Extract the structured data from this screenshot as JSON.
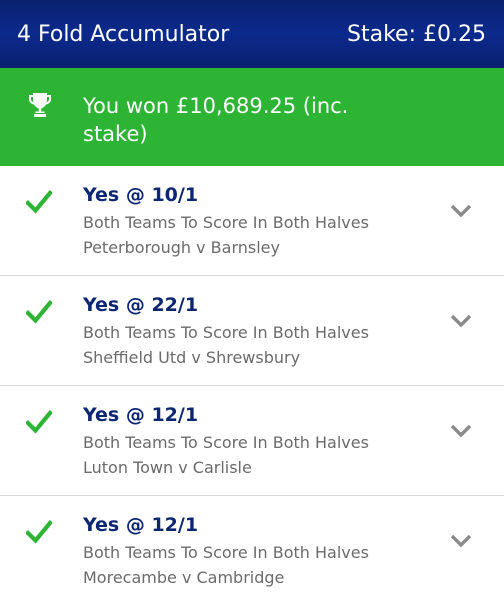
{
  "header": {
    "title": "4 Fold Accumulator",
    "stake_label": "Stake:",
    "stake_value": "£0.25"
  },
  "banner": {
    "icon": "trophy-icon",
    "text": "You won £10,689.25 (inc. stake)"
  },
  "colors": {
    "header_bg": "#0c2a8c",
    "win_green": "#2eb435",
    "odds_navy": "#0c2672",
    "check_green": "#2eb435"
  },
  "legs": [
    {
      "status_icon": "check-icon",
      "odds": "Yes @ 10/1",
      "market": "Both Teams To Score In Both Halves",
      "match": "Peterborough v Barnsley"
    },
    {
      "status_icon": "check-icon",
      "odds": "Yes @ 22/1",
      "market": "Both Teams To Score In Both Halves",
      "match": "Sheffield Utd v Shrewsbury"
    },
    {
      "status_icon": "check-icon",
      "odds": "Yes @ 12/1",
      "market": "Both Teams To Score In Both Halves",
      "match": "Luton Town v Carlisle"
    },
    {
      "status_icon": "check-icon",
      "odds": "Yes @ 12/1",
      "market": "Both Teams To Score In Both Halves",
      "match": "Morecambe v Cambridge"
    }
  ]
}
